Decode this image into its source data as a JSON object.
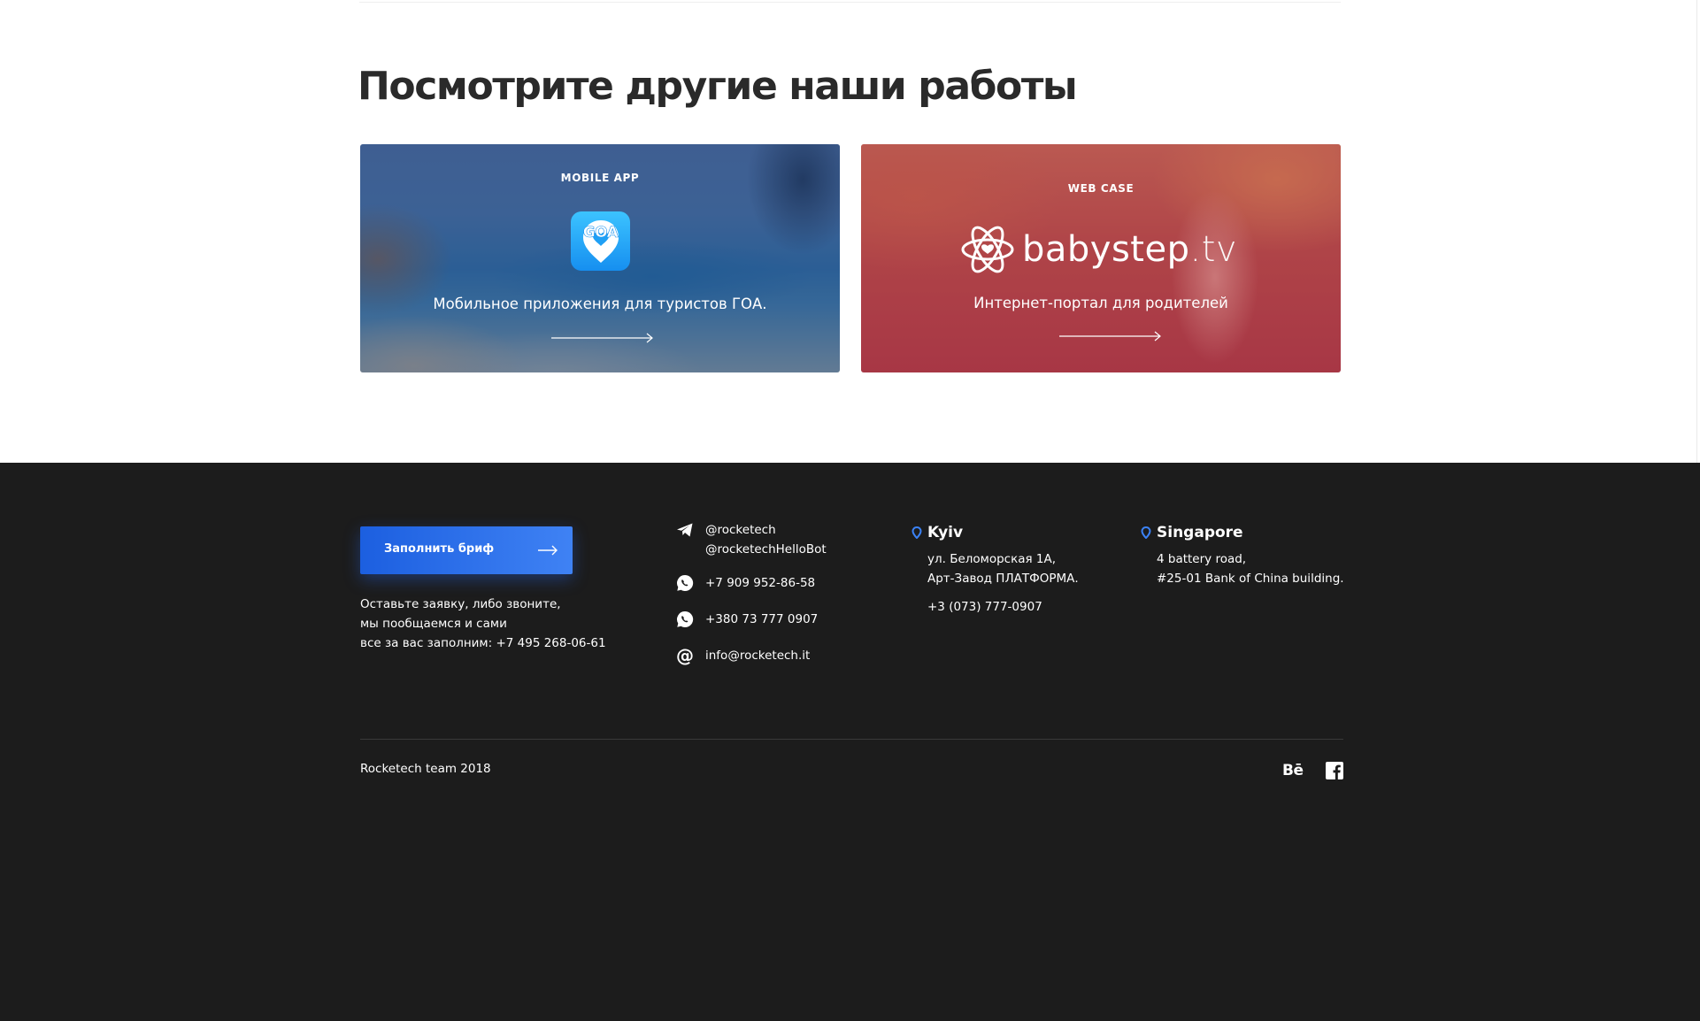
{
  "section": {
    "title": "Посмотрите другие наши работы"
  },
  "cards": [
    {
      "category": "MOBILE APP",
      "icon": "goa-app-icon",
      "icon_text": "GOA",
      "description": "Мобильное приложения для туристов ГОА.",
      "arrow": "arrow-right-icon"
    },
    {
      "category": "WEB CASE",
      "logo_main": "babystep",
      "logo_suffix": ".tv",
      "icon": "babystep-atom-heart-logo",
      "description": "Интернет-портал для родителей",
      "arrow": "arrow-right-icon"
    }
  ],
  "footer": {
    "brief_button": "Заполнить бриф",
    "note_lines": [
      "Оставьте заявку, либо звоните,",
      "мы пообщаемся и сами",
      "все за вас заполним: +7 495 268-06-61"
    ],
    "contacts": {
      "telegram": [
        "@rocketech",
        "@rocketechHelloBot"
      ],
      "whatsapp_1": "+7 909 952-86-58",
      "whatsapp_2": "+380 73 777 0907",
      "email": "info@rocketech.it"
    },
    "offices": [
      {
        "city": "Kyiv",
        "address_lines": [
          "ул. Беломорская 1А,",
          "Арт-Завод ПЛАТФОРМА."
        ],
        "phone": "+3 (073) 777-0907"
      },
      {
        "city": "Singapore",
        "address_lines": [
          "4 battery road,",
          "#25-01 Bank of China building."
        ]
      }
    ],
    "copyright": "Rocketech team 2018",
    "social": {
      "behance": "Bē",
      "facebook": "facebook-icon"
    }
  },
  "colors": {
    "footer_bg": "#1c1c1c",
    "accent_blue": "#2f6ff0",
    "title_text": "#2a2a2a",
    "pin_blue": "#3b82f6"
  }
}
